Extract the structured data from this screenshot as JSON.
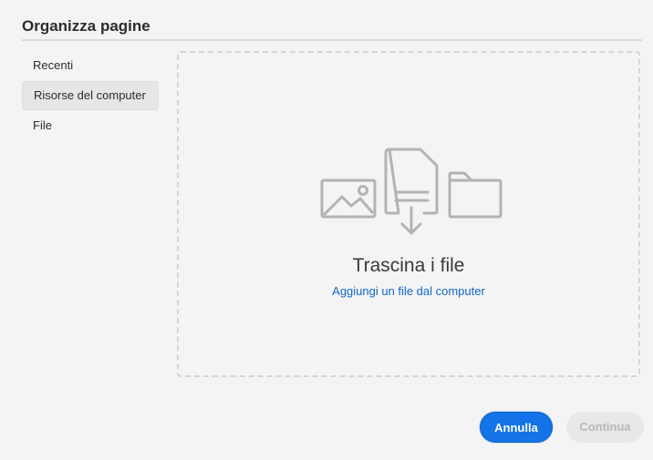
{
  "dialog": {
    "title": "Organizza pagine"
  },
  "sidebar": {
    "items": [
      {
        "label": "Recenti",
        "selected": false
      },
      {
        "label": "Risorse del computer",
        "selected": true
      },
      {
        "label": "File",
        "selected": false
      }
    ]
  },
  "dropzone": {
    "title": "Trascina i file",
    "link": "Aggiungi un file dal computer",
    "icons": [
      "image-icon",
      "document-download-icon",
      "folder-icon"
    ]
  },
  "buttons": {
    "cancel": "Annulla",
    "continue": "Continua",
    "continue_disabled": true
  },
  "colors": {
    "accent": "#1473e6",
    "link": "#1366c8",
    "icon_gray": "#b3b3b3",
    "background": "#f4f4f4"
  }
}
